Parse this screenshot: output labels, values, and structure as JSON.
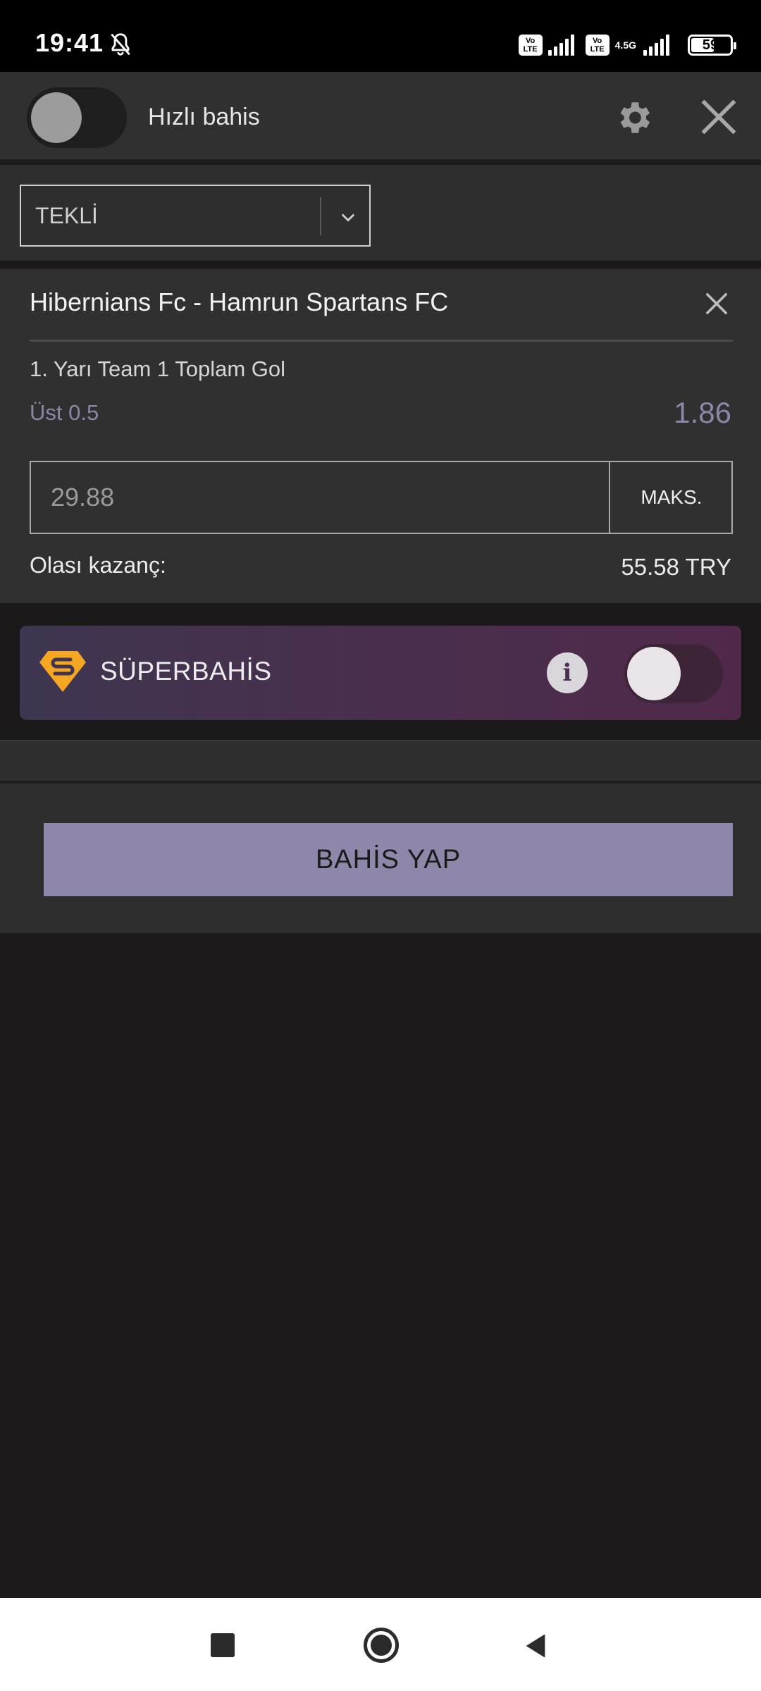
{
  "status_bar": {
    "time": "19:41",
    "network_label": "4.5G",
    "battery_percent": "59",
    "volte_label_1": "Vo LTE",
    "volte_label_2": "Vo LTE"
  },
  "header": {
    "quick_bet_label": "Hızlı bahis",
    "quick_bet_enabled": false
  },
  "bet_type": {
    "selected": "TEKLİ"
  },
  "selection": {
    "match": "Hibernians Fc - Hamrun Spartans FC",
    "market": "1. Yarı Team 1 Toplam Gol",
    "outcome": "Üst 0.5",
    "odds": "1.86",
    "stake_placeholder": "29.88",
    "max_label": "MAKS.",
    "winnings_label": "Olası kazanç:",
    "winnings_value": "55.58 TRY"
  },
  "superbet": {
    "label": "SÜPERBAHİS",
    "enabled": false
  },
  "actions": {
    "place_bet_label": "BAHİS YAP"
  },
  "colors": {
    "accent": "#8e87a9",
    "odds_text": "#8e86a6",
    "superbet_logo": "#f5a623",
    "panel_bg": "#303031",
    "page_bg": "#1e1a1b"
  }
}
